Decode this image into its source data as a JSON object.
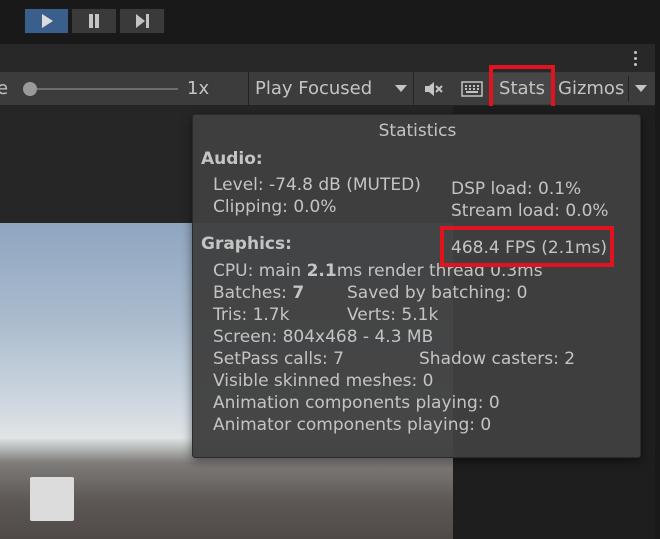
{
  "playbar": {
    "play_icon": "play-icon",
    "pause_icon": "pause-icon",
    "step_icon": "step-icon"
  },
  "toolbar": {
    "scale_label": "e",
    "scale_value": "1x",
    "play_mode": "Play Focused",
    "mute_icon": "mute-icon",
    "keyboard_icon": "keyboard-icon",
    "stats_label": "Stats",
    "gizmos_label": "Gizmos"
  },
  "stats": {
    "title": "Statistics",
    "audio_header": "Audio:",
    "level": "Level: -74.8 dB (MUTED)",
    "clipping": "Clipping: 0.0%",
    "dsp_load": "DSP load: 0.1%",
    "stream_load": "Stream load: 0.0%",
    "graphics_header": "Graphics:",
    "fps": "468.4 FPS (2.1ms)",
    "cpu_prefix": "CPU: main ",
    "cpu_main": "2.1",
    "cpu_suffix": "ms  render thread 0.3ms",
    "batches_prefix": "Batches: ",
    "batches_value": "7",
    "saved_by_batching": "Saved by batching: 0",
    "tris": "Tris: 1.7k",
    "verts": "Verts: 5.1k",
    "screen": "Screen: 804x468 - 4.3 MB",
    "setpass": "SetPass calls: 7",
    "shadow_casters": "Shadow casters: 2",
    "skinned_meshes": "Visible skinned meshes: 0",
    "animation_components": "Animation components playing: 0",
    "animator_components": "Animator components playing: 0"
  },
  "colors": {
    "highlight": "#e0131f",
    "play_active": "#3b5f8c"
  }
}
